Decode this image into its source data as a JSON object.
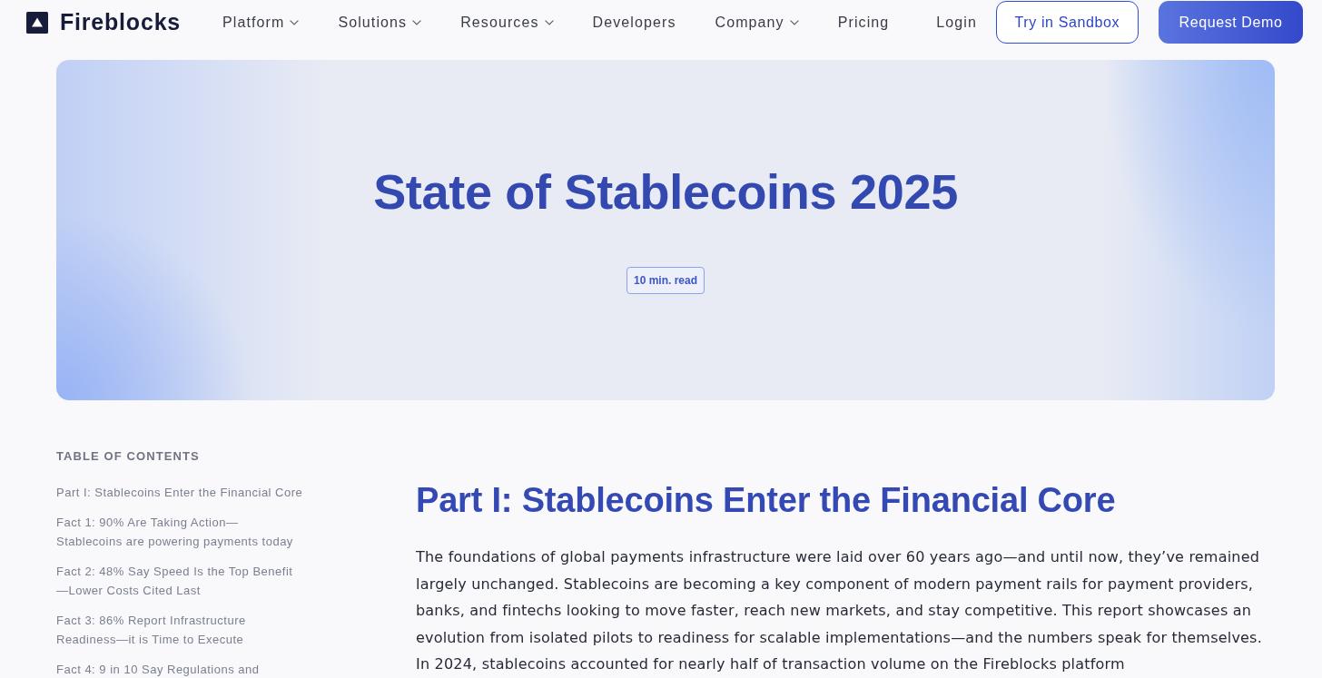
{
  "header": {
    "brand": "Fireblocks",
    "nav": [
      {
        "label": "Platform",
        "dropdown": true
      },
      {
        "label": "Solutions",
        "dropdown": true
      },
      {
        "label": "Resources",
        "dropdown": true
      },
      {
        "label": "Developers",
        "dropdown": false
      },
      {
        "label": "Company",
        "dropdown": true
      },
      {
        "label": "Pricing",
        "dropdown": false
      },
      {
        "label": "Login",
        "dropdown": false
      }
    ],
    "buttons": [
      {
        "label": "Try in Sandbox",
        "kind": "outline"
      },
      {
        "label": "Request Demo",
        "kind": "filled"
      }
    ]
  },
  "hero": {
    "title": "State of Stablecoins 2025",
    "badge": "10 min. read"
  },
  "toc": {
    "title": "TABLE OF CONTENTS",
    "items": [
      "Part I: Stablecoins Enter the Financial Core",
      "Fact 1: 90% Are Taking Action—Stablecoins are powering payments today",
      "Fact 2: 48% Say Speed Is the Top Benefit —Lower Costs Cited Last",
      "Fact 3: 86% Report Infrastructure Readiness—it is Time to Execute",
      "Fact 4: 9 in 10 Say Regulations and"
    ]
  },
  "article": {
    "heading": "Part I: Stablecoins Enter the Financial Core",
    "paragraph": "The foundations of global payments infrastructure were laid over 60 years ago—and until now, they’ve remained largely unchanged. Stablecoins are becoming a key component of modern payment rails for payment providers, banks, and fintechs looking to move faster, reach new markets, and stay competitive. This report showcases an evolution from isolated pilots to readiness for scalable implementations—and the numbers speak for themselves. In 2024, stablecoins accounted for nearly half of transaction volume on the Fireblocks platform"
  }
}
